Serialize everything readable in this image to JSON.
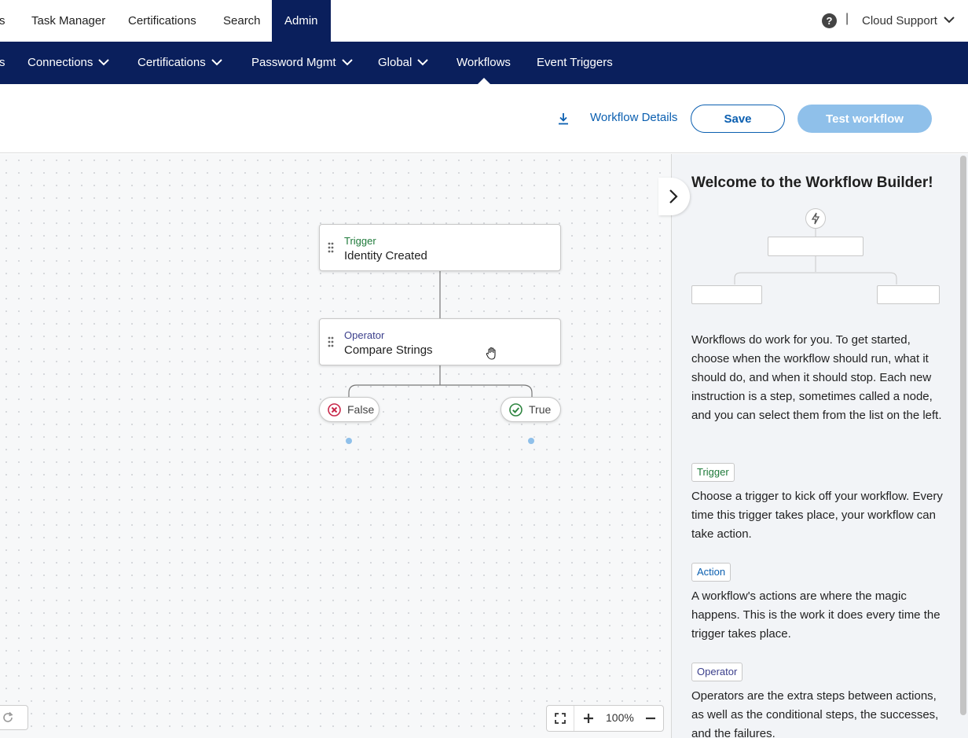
{
  "top_nav": {
    "partial_label": "s",
    "items": [
      "Task Manager",
      "Certifications",
      "Search",
      "Admin"
    ],
    "user": "Cloud Support",
    "help_icon": "question-circle-icon"
  },
  "sub_nav": {
    "partial_label": "s",
    "items": [
      "Connections",
      "Certifications",
      "Password Mgmt",
      "Global",
      "Workflows",
      "Event Triggers"
    ],
    "active": "Workflows"
  },
  "toolbar": {
    "details_label": "Workflow Details",
    "save_label": "Save",
    "test_label": "Test workflow"
  },
  "canvas": {
    "nodes": [
      {
        "kind": "Trigger",
        "title": "Identity Created"
      },
      {
        "kind": "Operator",
        "title": "Compare Strings"
      }
    ],
    "branches": {
      "false_label": "False",
      "true_label": "True"
    },
    "zoom": "100%"
  },
  "panel": {
    "title": "Welcome to the Workflow Builder!",
    "intro": "Workflows do work for you. To get started, choose when the workflow should run, what it should do, and when it should stop. Each new instruction is a step, sometimes called a node, and you can select them from the list on the left.",
    "sections": [
      {
        "tag": "Trigger",
        "text": "Choose a trigger to kick off your workflow. Every time this trigger takes place, your workflow can take action."
      },
      {
        "tag": "Action",
        "text": "A workflow's actions are where the magic happens. This is the work it does every time the trigger takes place."
      },
      {
        "tag": "Operator",
        "text": "Operators are the extra steps between actions, as well as the conditional steps, the successes, and the failures."
      }
    ]
  },
  "colors": {
    "nav_bg": "#0a1f5c",
    "accent": "#0b5fb0",
    "trigger_green": "#1e7a3a",
    "action_blue": "#0b5fb0",
    "operator_purple": "#3b3f8c",
    "false_red": "#c8284a",
    "true_green": "#2e8540"
  }
}
